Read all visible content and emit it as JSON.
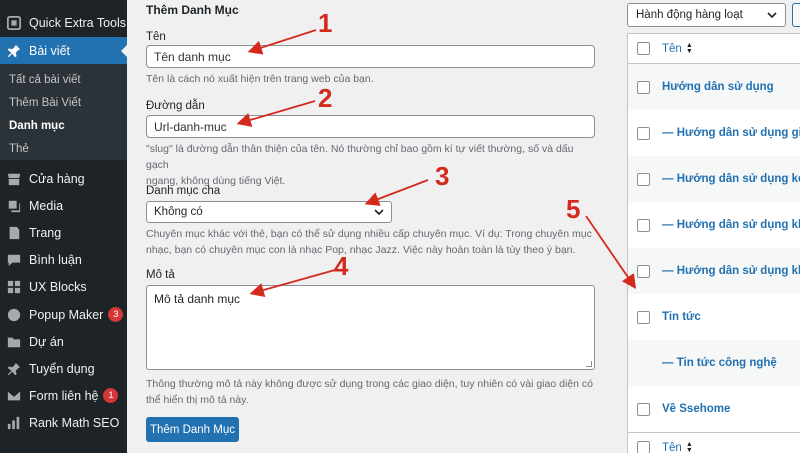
{
  "sidebar": {
    "top_items": [
      {
        "label": "Quick Extra Tools",
        "icon": "tools-icon"
      },
      {
        "label": "Bài viết",
        "icon": "pin-icon"
      }
    ],
    "submenu": [
      "Tất cả bài viết",
      "Thêm Bài Viết",
      "Danh mục",
      "Thẻ"
    ],
    "items": [
      {
        "label": "Cửa hàng",
        "icon": "store-icon"
      },
      {
        "label": "Media",
        "icon": "media-icon"
      },
      {
        "label": "Trang",
        "icon": "page-icon"
      },
      {
        "label": "Bình luận",
        "icon": "comment-icon"
      },
      {
        "label": "UX Blocks",
        "icon": "blocks-icon"
      },
      {
        "label": "Popup Maker",
        "icon": "popup-icon",
        "badge": "3"
      },
      {
        "label": "Dự án",
        "icon": "folder-icon"
      },
      {
        "label": "Tuyển dụng",
        "icon": "pin-icon"
      },
      {
        "label": "Form liên hệ",
        "icon": "mail-icon",
        "badge": "1"
      },
      {
        "label": "Rank Math SEO",
        "icon": "chart-icon"
      }
    ]
  },
  "form": {
    "title": "Thêm Danh Mục",
    "name_label": "Tên",
    "name_value": "Tên danh mục",
    "name_help": "Tên là cách nó xuất hiện trên trang web của bạn.",
    "slug_label": "Đường dẫn",
    "slug_value": "Url-danh-muc",
    "slug_help_1": "\"slug\" là đường dẫn thân thiện của tên. Nó thường chỉ bao gồm kí tự viết thường, số và dấu gạch",
    "slug_help_2": "ngang, không dùng tiếng Việt.",
    "parent_label": "Danh mục cha",
    "parent_value": "Không có",
    "parent_help_1": "Chuyên mục khác với thẻ, bạn có thể sử dụng nhiều cấp chuyên mục. Ví dụ: Trong chuyên mục",
    "parent_help_2": "nhạc, bạn có chuyên mục con là nhạc Pop, nhạc Jazz. Việc này hoàn toàn là tùy theo ý bạn.",
    "desc_label": "Mô tả",
    "desc_value": "Mô tả danh mục",
    "desc_help_1": "Thông thường mô tả này không được sử dụng trong các giao diện, tuy nhiên có vài giao diện có",
    "desc_help_2": "thể hiển thị mô tả này.",
    "submit_label": "Thêm Danh Mục"
  },
  "table": {
    "bulk_action": "Hành động hàng loạt",
    "column_name": "Tên",
    "rows": [
      "Hướng dẫn sử dụng",
      "— Hướng dẫn sử dụng giàn",
      "— Hướng dẫn sử dụng két",
      "— Hướng dẫn sử dụng khó",
      "— Hướng dẫn sử dụng khó",
      "Tin tức",
      "— Tin tức công nghệ",
      "Về Ssehome"
    ]
  },
  "annotations": [
    "1",
    "2",
    "3",
    "4",
    "5"
  ],
  "colors": {
    "sidebar_bg": "#1d2327",
    "accent": "#2271b1",
    "annotation": "#d42a1e",
    "badge": "#d63638"
  }
}
